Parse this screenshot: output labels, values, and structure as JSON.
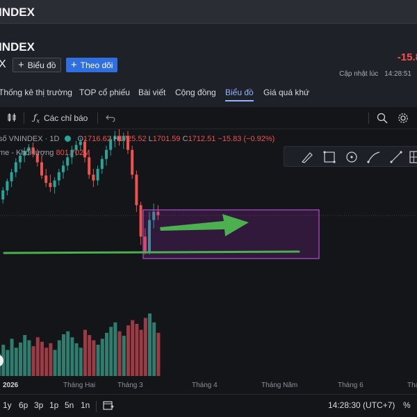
{
  "window": {
    "title": "INDEX"
  },
  "header": {
    "symbol_title": "INDEX",
    "symbol_short": "X",
    "chart_button": "Biểu đồ",
    "follow_button": "Theo dõi",
    "change": "-15.8",
    "updated_label": "Cập nhật lúc",
    "updated_time": "14:28:51"
  },
  "tabs": [
    {
      "label": "Thống kê thị trường",
      "active": false
    },
    {
      "label": "TOP cổ phiếu",
      "active": false
    },
    {
      "label": "Bài viết",
      "active": false
    },
    {
      "label": "Cộng đồng",
      "active": false
    },
    {
      "label": "Biểu đồ",
      "active": true
    },
    {
      "label": "Giá quá khứ",
      "active": false
    }
  ],
  "toolbar": {
    "indicators_label": "Các chỉ báo",
    "icons": [
      "candles-icon",
      "fx-icon",
      "undo-icon",
      "search-chart-icon",
      "settings-icon"
    ]
  },
  "legend": {
    "symbol": "số VNINDEX · 1D",
    "o_label": "O",
    "o_value": "1716.62",
    "h_label": "H",
    "h_value": "1725.52",
    "l_label": "L",
    "l_value": "1701.59",
    "c_label": "C",
    "c_value": "1712.51",
    "change": "−15.83 (−0.92%)",
    "volume_label": "me - Khối lượng",
    "volume_value": "801.702M"
  },
  "drawing_tools": [
    "brush-icon",
    "rectangle-icon",
    "circle-icon",
    "path-icon",
    "line-icon",
    "grid-icon"
  ],
  "x_axis": [
    "2026",
    "Tháng Hai",
    "Tháng 3",
    "Tháng 4",
    "Tháng Năm",
    "Tháng 6",
    "Tháng"
  ],
  "ranges": [
    "1y",
    "6p",
    "3p",
    "1p",
    "5n",
    "1n"
  ],
  "clock": "14:28:30 (UTC+7)",
  "percent_label": "%",
  "colors": {
    "up": "#26a69a",
    "down": "#ef5350",
    "accent": "#2f6fe0",
    "drawing_box": "#9c27b0",
    "drawing_arrow": "#4caf50",
    "drawing_line": "#4caf50"
  },
  "chart_data": {
    "type": "candlestick",
    "price_candles": [
      {
        "o": 1665,
        "h": 1678,
        "l": 1660,
        "c": 1675
      },
      {
        "o": 1675,
        "h": 1690,
        "l": 1670,
        "c": 1686
      },
      {
        "o": 1686,
        "h": 1700,
        "l": 1680,
        "c": 1697
      },
      {
        "o": 1697,
        "h": 1712,
        "l": 1690,
        "c": 1708
      },
      {
        "o": 1708,
        "h": 1725,
        "l": 1702,
        "c": 1720
      },
      {
        "o": 1720,
        "h": 1732,
        "l": 1712,
        "c": 1728
      },
      {
        "o": 1728,
        "h": 1738,
        "l": 1720,
        "c": 1734
      },
      {
        "o": 1734,
        "h": 1742,
        "l": 1728,
        "c": 1738
      },
      {
        "o": 1738,
        "h": 1744,
        "l": 1726,
        "c": 1730
      },
      {
        "o": 1730,
        "h": 1736,
        "l": 1715,
        "c": 1720
      },
      {
        "o": 1720,
        "h": 1728,
        "l": 1700,
        "c": 1704
      },
      {
        "o": 1704,
        "h": 1712,
        "l": 1690,
        "c": 1695
      },
      {
        "o": 1695,
        "h": 1705,
        "l": 1684,
        "c": 1690
      },
      {
        "o": 1690,
        "h": 1702,
        "l": 1682,
        "c": 1698
      },
      {
        "o": 1698,
        "h": 1712,
        "l": 1692,
        "c": 1708
      },
      {
        "o": 1708,
        "h": 1722,
        "l": 1700,
        "c": 1716
      },
      {
        "o": 1716,
        "h": 1730,
        "l": 1710,
        "c": 1726
      },
      {
        "o": 1726,
        "h": 1740,
        "l": 1718,
        "c": 1735
      },
      {
        "o": 1735,
        "h": 1746,
        "l": 1728,
        "c": 1741
      },
      {
        "o": 1741,
        "h": 1750,
        "l": 1734,
        "c": 1745
      },
      {
        "o": 1745,
        "h": 1748,
        "l": 1720,
        "c": 1726
      },
      {
        "o": 1726,
        "h": 1732,
        "l": 1700,
        "c": 1705
      },
      {
        "o": 1705,
        "h": 1712,
        "l": 1690,
        "c": 1698
      },
      {
        "o": 1698,
        "h": 1716,
        "l": 1692,
        "c": 1712
      },
      {
        "o": 1712,
        "h": 1728,
        "l": 1706,
        "c": 1724
      },
      {
        "o": 1724,
        "h": 1740,
        "l": 1716,
        "c": 1735
      },
      {
        "o": 1735,
        "h": 1752,
        "l": 1728,
        "c": 1748
      },
      {
        "o": 1748,
        "h": 1758,
        "l": 1738,
        "c": 1752
      },
      {
        "o": 1752,
        "h": 1760,
        "l": 1740,
        "c": 1746
      },
      {
        "o": 1746,
        "h": 1756,
        "l": 1736,
        "c": 1752
      },
      {
        "o": 1752,
        "h": 1758,
        "l": 1730,
        "c": 1735
      },
      {
        "o": 1735,
        "h": 1740,
        "l": 1700,
        "c": 1705
      },
      {
        "o": 1705,
        "h": 1710,
        "l": 1660,
        "c": 1668
      },
      {
        "o": 1668,
        "h": 1672,
        "l": 1620,
        "c": 1630
      },
      {
        "o": 1630,
        "h": 1640,
        "l": 1608,
        "c": 1612
      },
      {
        "o": 1612,
        "h": 1660,
        "l": 1608,
        "c": 1650
      },
      {
        "o": 1650,
        "h": 1670,
        "l": 1640,
        "c": 1660
      },
      {
        "o": 1660,
        "h": 1668,
        "l": 1650,
        "c": 1656
      }
    ],
    "volumes": [
      30,
      42,
      35,
      50,
      38,
      45,
      55,
      48,
      40,
      52,
      46,
      38,
      44,
      35,
      48,
      56,
      60,
      52,
      44,
      38,
      62,
      55,
      48,
      42,
      50,
      58,
      66,
      72,
      60,
      54,
      68,
      75,
      70,
      62,
      78,
      84,
      72,
      58
    ],
    "price_ylim": [
      1600,
      1760
    ]
  }
}
